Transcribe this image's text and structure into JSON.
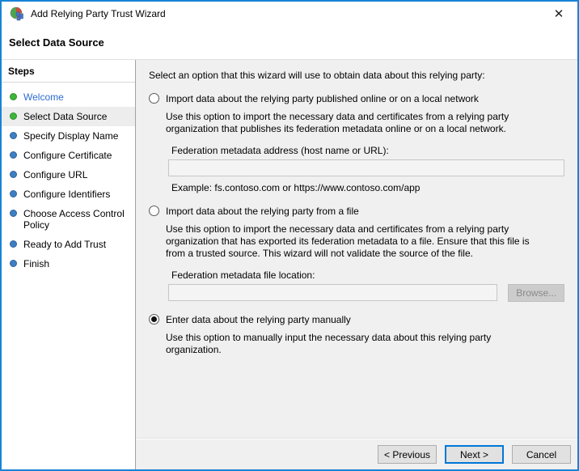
{
  "window": {
    "title": "Add Relying Party Trust Wizard",
    "close_glyph": "✕"
  },
  "page": {
    "heading": "Select Data Source"
  },
  "sidebar": {
    "heading": "Steps",
    "items": [
      {
        "label": "Welcome",
        "state": "visited",
        "bullet": "green"
      },
      {
        "label": "Select Data Source",
        "state": "current",
        "bullet": "green"
      },
      {
        "label": "Specify Display Name",
        "state": "upcoming",
        "bullet": "blue"
      },
      {
        "label": "Configure Certificate",
        "state": "upcoming",
        "bullet": "blue"
      },
      {
        "label": "Configure URL",
        "state": "upcoming",
        "bullet": "blue"
      },
      {
        "label": "Configure Identifiers",
        "state": "upcoming",
        "bullet": "blue"
      },
      {
        "label": "Choose Access Control Policy",
        "state": "upcoming",
        "bullet": "blue"
      },
      {
        "label": "Ready to Add Trust",
        "state": "upcoming",
        "bullet": "blue"
      },
      {
        "label": "Finish",
        "state": "upcoming",
        "bullet": "blue"
      }
    ]
  },
  "main": {
    "instruction": "Select an option that this wizard will use to obtain data about this relying party:",
    "options": [
      {
        "label": "Import data about the relying party published online or on a local network",
        "selected": false,
        "description": "Use this option to import the necessary data and certificates from a relying party organization that publishes its federation metadata online or on a local network.",
        "field_label": "Federation metadata address (host name or URL):",
        "field_value": "",
        "example": "Example: fs.contoso.com or https://www.contoso.com/app"
      },
      {
        "label": "Import data about the relying party from a file",
        "selected": false,
        "description": "Use this option to import the necessary data and certificates from a relying party organization that has exported its federation metadata to a file. Ensure that this file is from a trusted source.  This wizard will not validate the source of the file.",
        "field_label": "Federation metadata file location:",
        "field_value": "",
        "browse_label": "Browse..."
      },
      {
        "label": "Enter data about the relying party manually",
        "selected": true,
        "description": "Use this option to manually input the necessary data about this relying party organization."
      }
    ]
  },
  "footer": {
    "previous_label": "< Previous",
    "next_label": "Next >",
    "cancel_label": "Cancel"
  },
  "colors": {
    "window_border": "#1883d7",
    "focus_accent": "#0078d7",
    "step_done_green": "#3db639",
    "step_upcoming_blue": "#3e7fc1",
    "visited_link_blue": "#2b6bd3",
    "panel_gray": "#f0f0f0"
  }
}
